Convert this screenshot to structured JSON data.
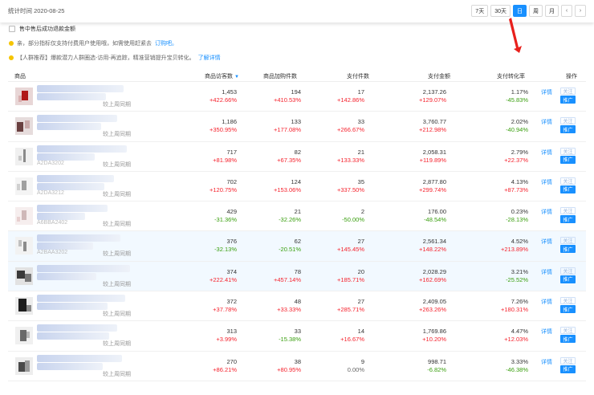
{
  "header": {
    "stat_time": "统计时间 2020-08-25",
    "periods": [
      {
        "label": "7天",
        "active": false
      },
      {
        "label": "30天",
        "active": false
      },
      {
        "label": "日",
        "active": true
      },
      {
        "label": "周",
        "active": false
      },
      {
        "label": "月",
        "active": false
      }
    ],
    "prev_icon": "‹",
    "next_icon": "›"
  },
  "filter": {
    "checkbox_label": "售中售后成功退款金额"
  },
  "notices": [
    {
      "text": "亲，部分指标仅支持付费用户使用哦，如需使用赶紧去",
      "link": "订购吧。"
    },
    {
      "text": "【人群推荐】爆款潜力人群圈选-访用-再追踪，精准营销提升宝贝转化。",
      "link": "了解详情"
    }
  ],
  "table": {
    "columns": {
      "product": "商品",
      "visitors": "商品访客数",
      "cart": "商品加购件数",
      "pay_items": "支付件数",
      "pay_amount": "支付金额",
      "conversion": "支付转化率",
      "ops": "操作"
    },
    "compare_label": "较上周同期",
    "detail_label": "详情",
    "follow_label": "关注",
    "promote_label": "推广",
    "rows": [
      {
        "code": "",
        "visitors": "1,453",
        "visitors_chg": "+422.66%",
        "cart": "194",
        "cart_chg": "+410.53%",
        "items": "17",
        "items_chg": "+142.86%",
        "amount": "2,137.26",
        "amount_chg": "+129.07%",
        "conv": "1.17%",
        "conv_chg": "-45.83%"
      },
      {
        "code": "",
        "visitors": "1,186",
        "visitors_chg": "+350.95%",
        "cart": "133",
        "cart_chg": "+177.08%",
        "items": "33",
        "items_chg": "+266.67%",
        "amount": "3,760.77",
        "amount_chg": "+212.98%",
        "conv": "2.02%",
        "conv_chg": "-40.94%"
      },
      {
        "code": "A2DA3202",
        "visitors": "717",
        "visitors_chg": "+81.98%",
        "cart": "82",
        "cart_chg": "+67.35%",
        "items": "21",
        "items_chg": "+133.33%",
        "amount": "2,058.31",
        "amount_chg": "+119.89%",
        "conv": "2.79%",
        "conv_chg": "+22.37%"
      },
      {
        "code": "A2DA3212",
        "visitors": "702",
        "visitors_chg": "+120.75%",
        "cart": "124",
        "cart_chg": "+153.06%",
        "items": "35",
        "items_chg": "+337.50%",
        "amount": "2,877.80",
        "amount_chg": "+299.74%",
        "conv": "4.13%",
        "conv_chg": "+87.73%"
      },
      {
        "code": "A6BBA2402",
        "visitors": "429",
        "visitors_chg": "-31.36%",
        "cart": "21",
        "cart_chg": "-32.26%",
        "items": "2",
        "items_chg": "-50.00%",
        "amount": "176.00",
        "amount_chg": "-48.54%",
        "conv": "0.23%",
        "conv_chg": "-28.13%"
      },
      {
        "code": "A2BAA3202",
        "visitors": "376",
        "visitors_chg": "-32.13%",
        "cart": "62",
        "cart_chg": "-20.51%",
        "items": "27",
        "items_chg": "+145.45%",
        "amount": "2,561.34",
        "amount_chg": "+148.22%",
        "conv": "4.52%",
        "conv_chg": "+213.89%"
      },
      {
        "code": "",
        "visitors": "374",
        "visitors_chg": "+222.41%",
        "cart": "78",
        "cart_chg": "+457.14%",
        "items": "20",
        "items_chg": "+185.71%",
        "amount": "2,028.29",
        "amount_chg": "+162.69%",
        "conv": "3.21%",
        "conv_chg": "-25.52%"
      },
      {
        "code": "",
        "visitors": "372",
        "visitors_chg": "+37.78%",
        "cart": "48",
        "cart_chg": "+33.33%",
        "items": "27",
        "items_chg": "+285.71%",
        "amount": "2,409.05",
        "amount_chg": "+263.26%",
        "conv": "7.26%",
        "conv_chg": "+180.31%"
      },
      {
        "code": "",
        "visitors": "313",
        "visitors_chg": "+3.99%",
        "cart": "33",
        "cart_chg": "-15.38%",
        "items": "14",
        "items_chg": "+16.67%",
        "amount": "1,769.86",
        "amount_chg": "+10.20%",
        "conv": "4.47%",
        "conv_chg": "+12.03%"
      },
      {
        "code": "",
        "visitors": "270",
        "visitors_chg": "+86.21%",
        "cart": "38",
        "cart_chg": "+80.95%",
        "items": "9",
        "items_chg": "0.00%",
        "amount": "998.71",
        "amount_chg": "-6.82%",
        "conv": "3.33%",
        "conv_chg": "-46.38%"
      }
    ]
  },
  "colors": {
    "accent": "#1890ff",
    "up": "#f5222d",
    "down": "#389e0d",
    "notice_dot": "#f5c400",
    "annotation_arrow": "#e8201c"
  }
}
